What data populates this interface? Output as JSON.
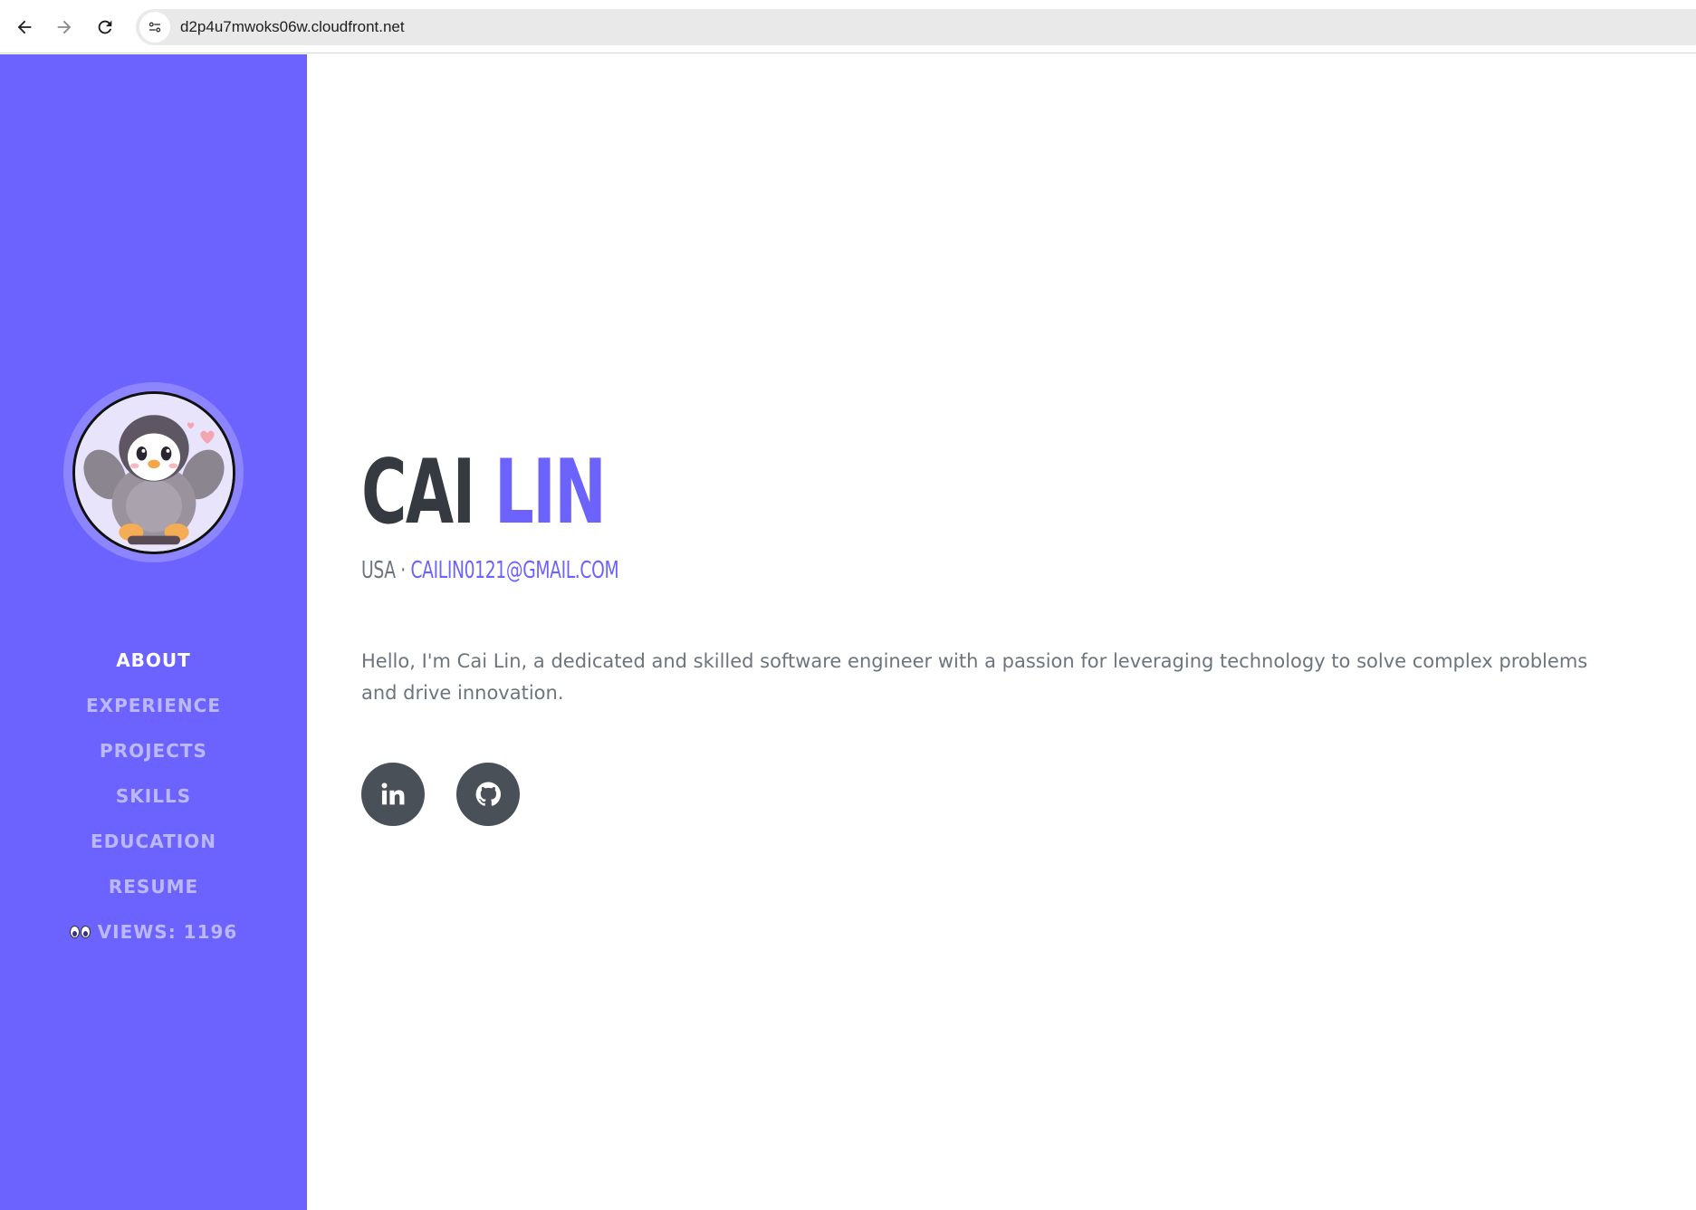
{
  "browser": {
    "url": "d2p4u7mwoks06w.cloudfront.net"
  },
  "sidebar": {
    "background": "#6c63ff",
    "nav": [
      {
        "label": "ABOUT",
        "active": true
      },
      {
        "label": "EXPERIENCE",
        "active": false
      },
      {
        "label": "PROJECTS",
        "active": false
      },
      {
        "label": "SKILLS",
        "active": false
      },
      {
        "label": "EDUCATION",
        "active": false
      },
      {
        "label": "RESUME",
        "active": false
      }
    ],
    "views": {
      "icon": "eyes-icon",
      "label": "VIEWS: 1196"
    }
  },
  "main": {
    "first_name": "CAI",
    "last_name": "LIN",
    "location": "USA ·",
    "email": "CAILIN0121@GMAIL.COM",
    "intro": "Hello, I'm Cai Lin, a dedicated and skilled software engineer with a passion for leveraging technology to solve complex problems and drive innovation.",
    "social": [
      {
        "icon": "linkedin-icon"
      },
      {
        "icon": "github-icon"
      }
    ]
  },
  "colors": {
    "accent": "#6c63ff",
    "heading_dark": "#343a40",
    "text_muted": "#6c757d",
    "social_bg": "#495057"
  }
}
